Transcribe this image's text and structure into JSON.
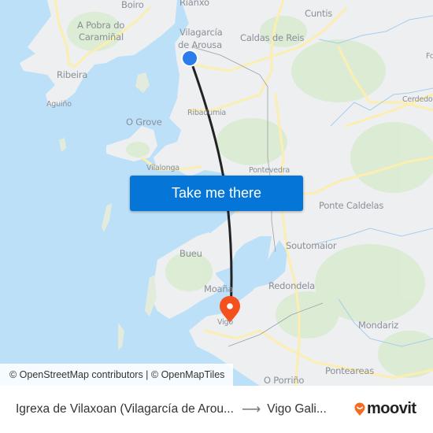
{
  "map": {
    "places": [
      {
        "id": "boiro",
        "label": "Boiro"
      },
      {
        "id": "rianxo",
        "label": "Rianxo"
      },
      {
        "id": "a-pobra",
        "label": "A Pobra do"
      },
      {
        "id": "a-pobra-2",
        "label": "Caramiñal"
      },
      {
        "id": "vilagarcia",
        "label": "Vilagarcía"
      },
      {
        "id": "vilagarcia-2",
        "label": "de Arousa"
      },
      {
        "id": "caldas",
        "label": "Caldas de Reis"
      },
      {
        "id": "cuntis",
        "label": "Cuntis"
      },
      {
        "id": "fo",
        "label": "Fo"
      },
      {
        "id": "ribeira",
        "label": "Ribeira"
      },
      {
        "id": "aguino",
        "label": "Aguiño"
      },
      {
        "id": "cerdedo",
        "label": "Cerdedo"
      },
      {
        "id": "o-grove",
        "label": "O Grove"
      },
      {
        "id": "ribadumia",
        "label": "Ribadumia"
      },
      {
        "id": "vilalonga",
        "label": "Vilalonga"
      },
      {
        "id": "pontevedra",
        "label": "Pontevedra"
      },
      {
        "id": "ponte-caldelas",
        "label": "Ponte Caldelas"
      },
      {
        "id": "soutomaior",
        "label": "Soutomaior"
      },
      {
        "id": "bueu",
        "label": "Bueu"
      },
      {
        "id": "moana",
        "label": "Moaña"
      },
      {
        "id": "redondela",
        "label": "Redondela"
      },
      {
        "id": "vigo",
        "label": "Vigo"
      },
      {
        "id": "mondariz",
        "label": "Mondariz"
      },
      {
        "id": "ponteareas",
        "label": "Ponteareas"
      },
      {
        "id": "o-porrino",
        "label": "O Porriño"
      }
    ],
    "origin_marker": {
      "icon": "origin-dot-icon",
      "color": "#2b7de9"
    },
    "destination_marker": {
      "icon": "destination-pin-icon",
      "color": "#f4511e"
    },
    "route_color": "#222222",
    "cta_label": "Take me there",
    "cta_color": "#0575d8",
    "attribution": "© OpenStreetMap contributors | © OpenMapTiles"
  },
  "footer": {
    "origin": "Igrexa de Vilaxoan (Vilagarcía de Arou...",
    "arrow_icon": "arrow-right-icon",
    "destination": "Vigo Gali...",
    "brand": "moovit",
    "brand_color": "#f46b21"
  }
}
